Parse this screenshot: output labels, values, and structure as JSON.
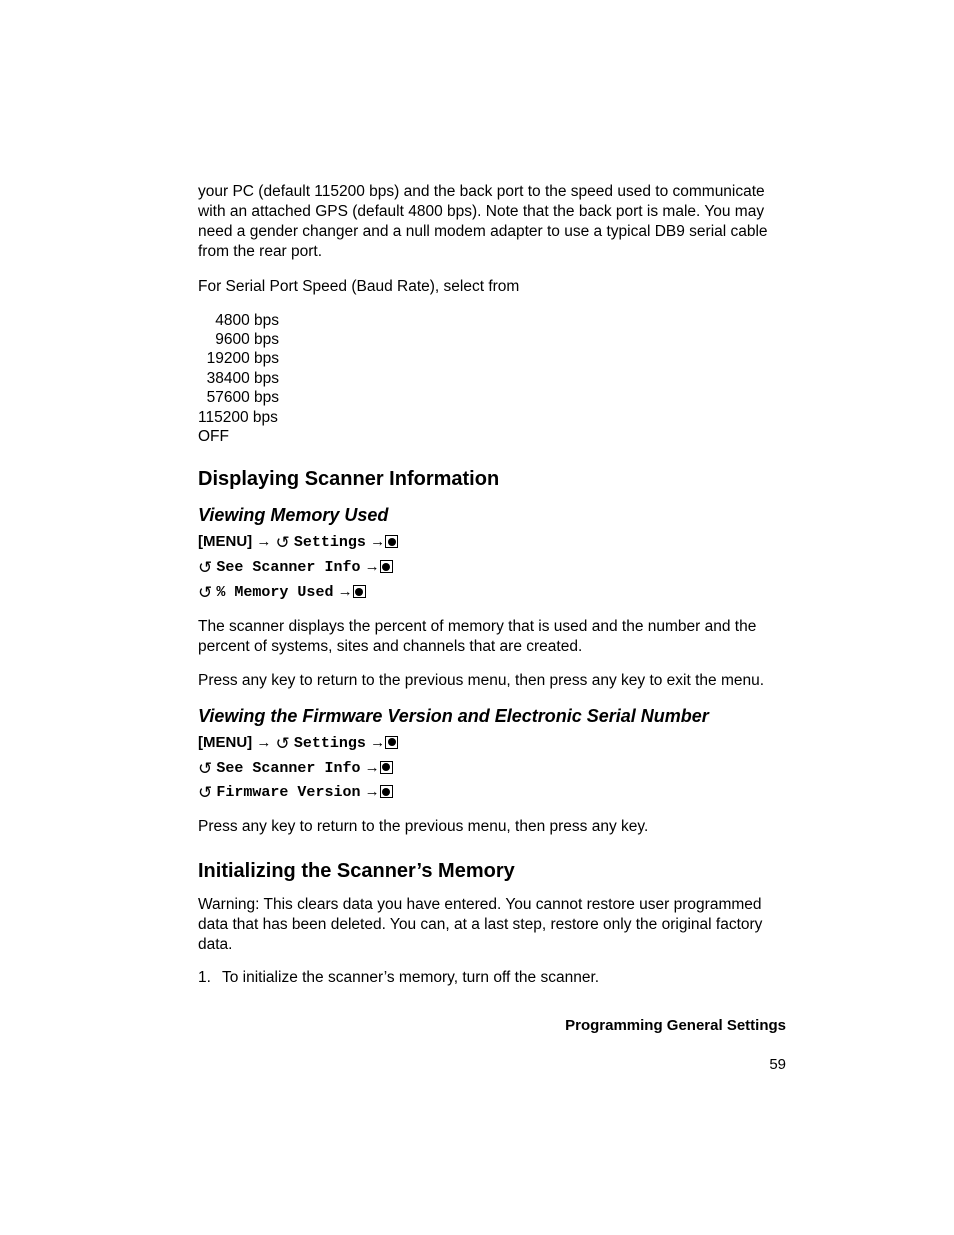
{
  "intro_para": "your PC (default 115200 bps) and the back port to the speed used to communicate with an attached GPS (default 4800 bps). Note that the back port is male. You may need a gender changer and a null modem adapter to use a typical DB9 serial cable from the rear port.",
  "baud_intro": "For Serial Port Speed (Baud Rate), select from",
  "baud_rates": [
    "    4800 bps",
    "    9600 bps",
    "  19200 bps",
    "  38400 bps",
    "  57600 bps",
    "115200 bps",
    "OFF"
  ],
  "h_display": "Displaying Scanner Information",
  "h_memory": "Viewing Memory Used",
  "menu_label": "[MENU]",
  "arrow": "→",
  "m_settings": "Settings",
  "m_see_info": "See Scanner Info",
  "m_mem_used": "% Memory Used",
  "mem_para1": "The scanner displays the percent of memory that is used and the number and the percent of systems, sites and channels that are created.",
  "mem_para2": "Press any key to return to the previous menu, then press any key to exit the menu.",
  "h_firmware": "Viewing the Firmware Version and Electronic Serial Number",
  "m_firmware": "Firmware Version",
  "fw_para": "Press any key to return to the previous menu, then press any key.",
  "h_init": "Initializing the Scanner’s Memory",
  "warn_label": "Warning:",
  "warn_1": " This clears data ",
  "warn_you": "you",
  "warn_2": " have entered. You cannot restore user programmed data that has been deleted. You can, at a last step, restore only the original factory data.",
  "step1_num": "1.",
  "step1_text": "To initialize the scanner’s memory, turn off the scanner.",
  "footer": "Programming General Settings",
  "page_no": "59"
}
